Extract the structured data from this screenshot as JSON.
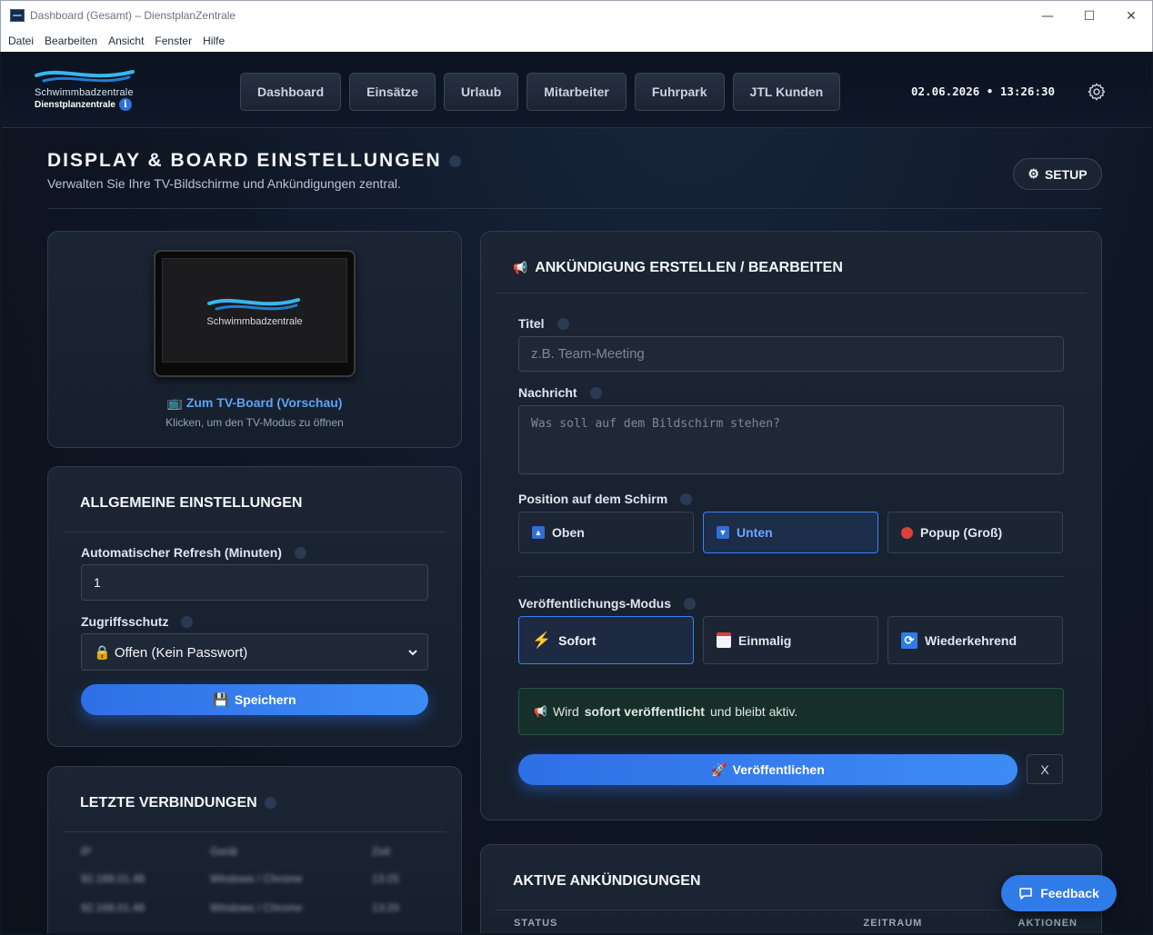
{
  "window": {
    "title": "Dashboard (Gesamt) – DienstplanZentrale",
    "controls": {
      "minimize": "—",
      "maximize": "☐",
      "close": "✕"
    }
  },
  "menubar": [
    "Datei",
    "Bearbeiten",
    "Ansicht",
    "Fenster",
    "Hilfe"
  ],
  "logo": {
    "brand": "Schwimmbadzentrale",
    "subtitle": "Dienstplanzentrale",
    "info": "i"
  },
  "nav": [
    "Dashboard",
    "Einsätze",
    "Urlaub",
    "Mitarbeiter",
    "Fuhrpark",
    "JTL Kunden"
  ],
  "clock": "02.06.2026 • 13:26:30",
  "page": {
    "title": "DISPLAY & BOARD EINSTELLUNGEN",
    "subtitle": "Verwalten Sie Ihre TV-Bildschirme und Ankündigungen zentral.",
    "setup_label": "SETUP"
  },
  "tv": {
    "screen_brand": "Schwimmbadzentrale",
    "icon": "📺",
    "link_label": "Zum TV-Board (Vorschau)",
    "hint": "Klicken, um den TV-Modus zu öffnen"
  },
  "general": {
    "title": "ALLGEMEINE EINSTELLUNGEN",
    "refresh_label": "Automatischer Refresh (Minuten)",
    "refresh_value": "1",
    "access_label": "Zugriffsschutz",
    "access_value": "Offen (Kein Passwort)",
    "access_icon": "🔒",
    "save_icon": "💾",
    "save_label": "Speichern"
  },
  "connections": {
    "title": "LETZTE VERBINDUNGEN",
    "columns": [
      "IP",
      "Gerät",
      "Zeit"
    ],
    "rows": [
      [
        "92.168.01.48",
        "Windows / Chrome",
        "13:25"
      ],
      [
        "92.168.01.48",
        "Windows / Chrome",
        "13:20"
      ]
    ]
  },
  "announce": {
    "title": "ANKÜNDIGUNG ERSTELLEN / BEARBEITEN",
    "title_icon": "📢",
    "title_field_label": "Titel",
    "title_placeholder": "z.B. Team-Meeting",
    "message_label": "Nachricht",
    "message_placeholder": "Was soll auf dem Bildschirm stehen?",
    "position_label": "Position auf dem Schirm",
    "positions": [
      "Oben",
      "Unten",
      "Popup (Groß)"
    ],
    "position_selected": "Unten",
    "mode_label": "Veröffentlichungs-Modus",
    "modes": [
      "Sofort",
      "Einmalig",
      "Wiederkehrend"
    ],
    "mode_selected": "Sofort",
    "notice_icon": "📢",
    "notice_pre": "Wird",
    "notice_bold": "sofort veröffentlicht",
    "notice_post": "und bleibt aktiv.",
    "publish_icon": "🚀",
    "publish_label": "Veröffentlichen",
    "close_label": "X"
  },
  "active": {
    "title": "AKTIVE ANKÜNDIGUNGEN",
    "columns": [
      "STATUS",
      "ZEITRAUM",
      "AKTIONEN"
    ]
  },
  "feedback_label": "Feedback",
  "colors": {
    "accent": "#3b82f6",
    "background": "#0f1724",
    "card": "#1b2534",
    "notice": "#163029"
  }
}
